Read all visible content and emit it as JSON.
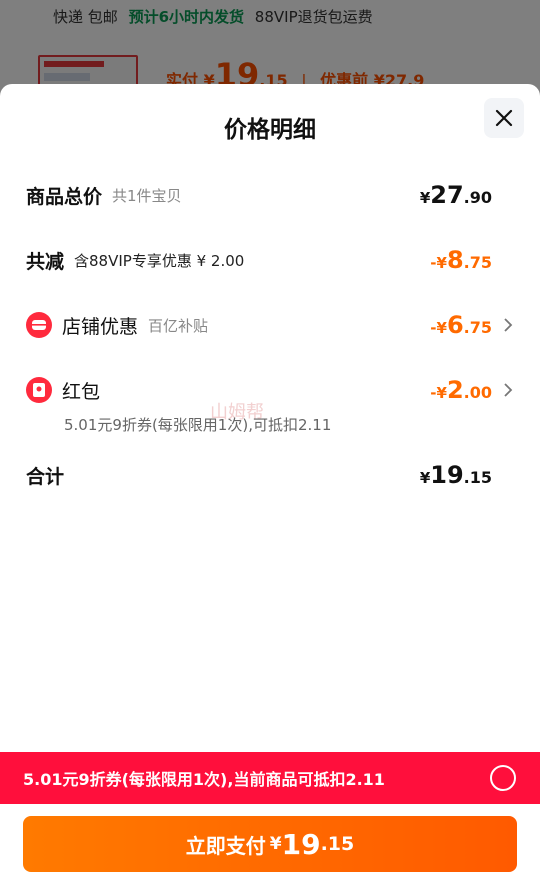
{
  "background": {
    "shipping_prefix": "快递 包邮",
    "shipping_highlight": "预计6小时内发货",
    "shipping_suffix": "88VIP退货包运费",
    "paid_label": "实付",
    "paid_sign": "¥",
    "paid_int": "19",
    "paid_dec": ".15",
    "before_discount": "优惠前 ¥27.9"
  },
  "sheet": {
    "title": "价格明细",
    "close_icon": "close-icon"
  },
  "rows": {
    "total": {
      "label": "商品总价",
      "sub": "共1件宝贝",
      "sign": "¥",
      "int": "27",
      "dec": ".90"
    },
    "reduce": {
      "label": "共减",
      "sub": "含88VIP专享优惠 ¥ 2.00",
      "sign": "-¥",
      "int": "8",
      "dec": ".75"
    },
    "shop": {
      "label": "店铺优惠",
      "sub": "百亿补贴",
      "sign": "-¥",
      "int": "6",
      "dec": ".75",
      "icon": "store-coupon-icon"
    },
    "redpacket": {
      "label": "红包",
      "sign": "-¥",
      "int": "2",
      "dec": ".00",
      "icon": "red-envelope-icon",
      "note": "5.01元9折券(每张限用1次),可抵扣2.11"
    },
    "sum": {
      "label": "合计",
      "sign": "¥",
      "int": "19",
      "dec": ".15"
    }
  },
  "watermark": "山姆帮",
  "coupon_bar": {
    "text": "5.01元9折券(每张限用1次),当前商品可抵扣2.11"
  },
  "pay_button": {
    "label": "立即支付",
    "sign": "¥",
    "int": "19",
    "dec": ".15"
  },
  "colors": {
    "accent": "#ff6a00",
    "coupon_bg": "#ff0f3c",
    "icon_red": "#ff2a3d"
  }
}
